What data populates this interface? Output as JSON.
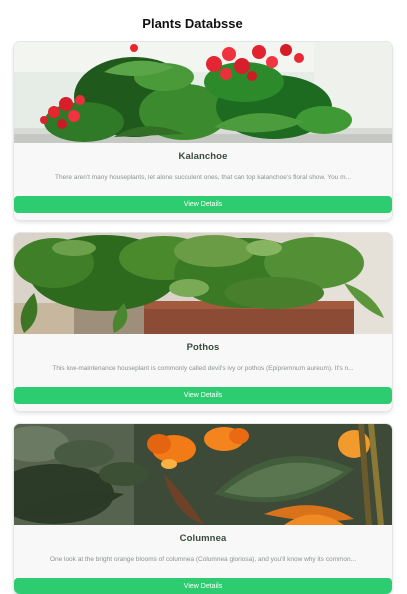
{
  "page": {
    "title": "Plants Databsse"
  },
  "plants": [
    {
      "name": "Kalanchoe",
      "description": "There aren't many houseplants, let alone succulent ones, that can top kalanchoe's floral show. You m...",
      "button_label": "View Details"
    },
    {
      "name": "Pothos",
      "description": "This low-maintenance houseplant is commonly called devil's ivy or pothos (Epipremnum aureum). It's n...",
      "button_label": "View Details"
    },
    {
      "name": "Columnea",
      "description": "One look at the bright orange blooms of columnea (Columnea gloriosa), and you'll know why its common...",
      "button_label": "View Details"
    }
  ],
  "colors": {
    "accent": "#2ecc71",
    "card_background": "#f7f8f7",
    "title_text": "#3b4a3f",
    "description_text": "#8c9490"
  }
}
